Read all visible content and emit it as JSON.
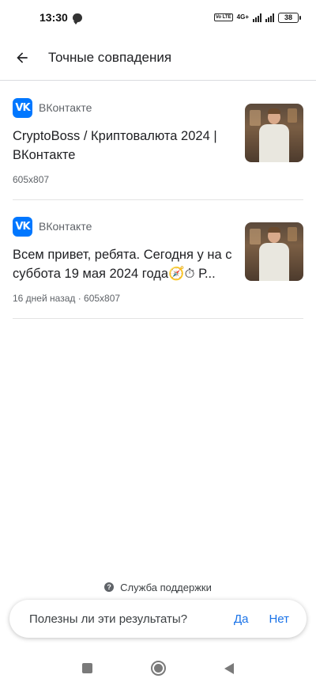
{
  "status_bar": {
    "time": "13:30",
    "network": "4G+",
    "volte": "Vo LTE",
    "battery": "38"
  },
  "header": {
    "title": "Точные совпадения",
    "back_icon": "arrow-left-icon"
  },
  "results": [
    {
      "source": "ВКонтакте",
      "title": "CryptoBoss / Криптовалюта 2024 | ВКонтакте",
      "meta": "605x807"
    },
    {
      "source": "ВКонтакте",
      "title": "Всем привет, ребята. Сегодня у на с суббота 19 мая 2024 года🧭⏱ Р...",
      "meta": "16 дней назад · 605x807"
    }
  ],
  "footer": {
    "support_label": "Служба поддержки",
    "feedback_question": "Полезны ли эти результаты?",
    "yes_label": "Да",
    "no_label": "Нет"
  },
  "colors": {
    "vk_brand": "#0077ff",
    "link_blue": "#1a73e8"
  }
}
